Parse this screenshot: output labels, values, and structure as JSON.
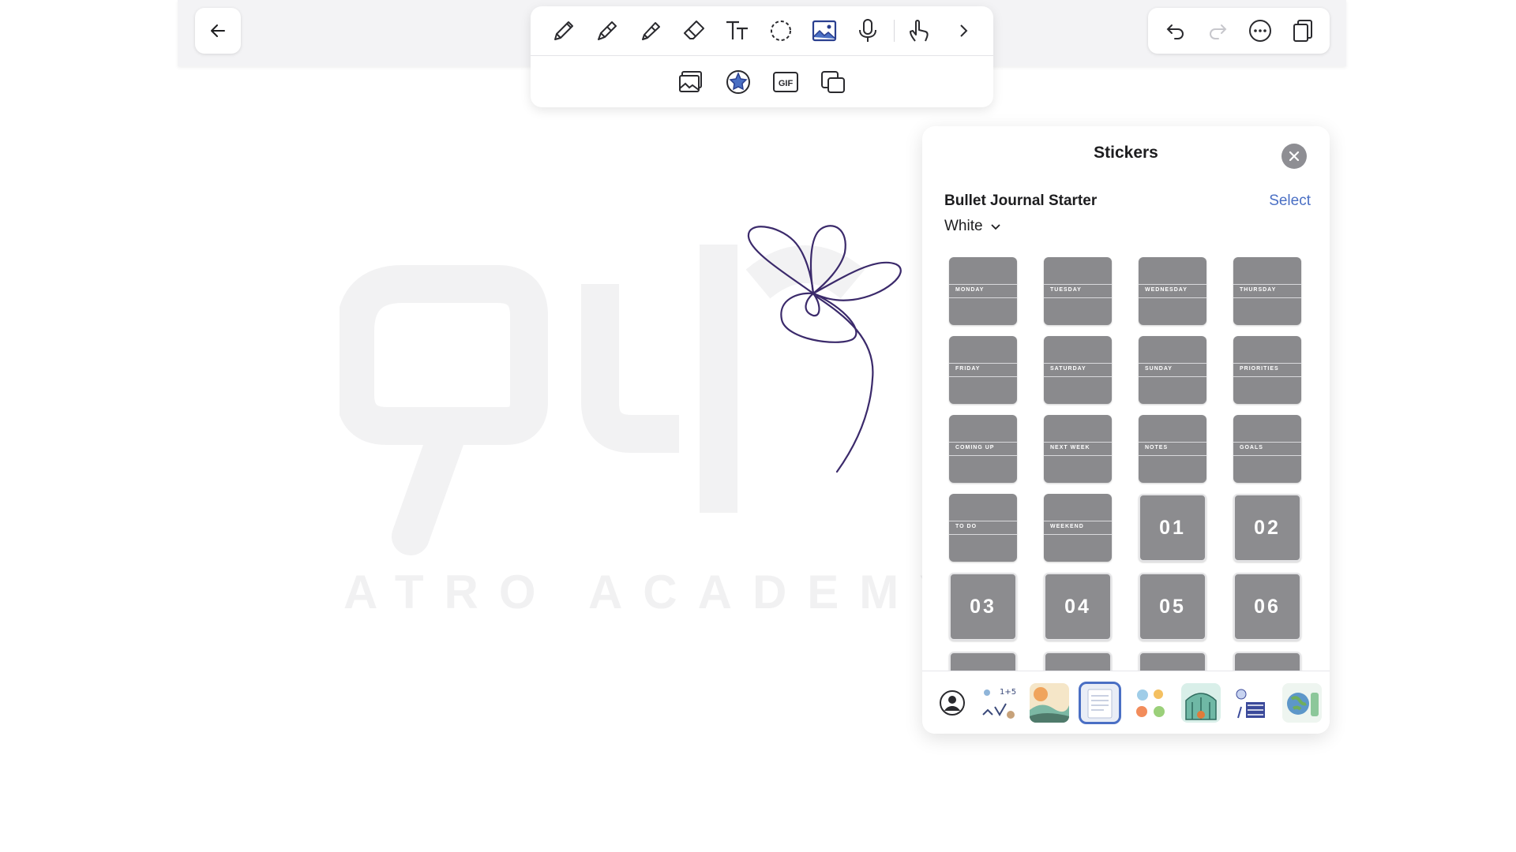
{
  "toolbar": {
    "tools": [
      "pencil-icon",
      "pen-icon",
      "highlighter-icon",
      "eraser-icon",
      "text-icon",
      "lasso-icon",
      "image-icon",
      "microphone-icon",
      "finger-touch-icon",
      "chevron-right-icon"
    ],
    "secondary": [
      "photo-library-icon",
      "sticker-icon",
      "gif-icon",
      "copy-sticker-icon"
    ],
    "active_tool": "image-icon",
    "active_secondary": "sticker-icon",
    "gif_label": "GIF"
  },
  "actions": [
    "undo-icon",
    "redo-icon",
    "more-icon",
    "pages-icon"
  ],
  "watermark": {
    "text": "ATRO ACADEMY"
  },
  "panel": {
    "title": "Stickers",
    "pack_name": "Bullet Journal Starter",
    "select_label": "Select",
    "variant": "White",
    "label_stickers": [
      "MONDAY",
      "TUESDAY",
      "WEDNESDAY",
      "THURSDAY",
      "FRIDAY",
      "SATURDAY",
      "SUNDAY",
      "PRIORITIES",
      "COMING UP",
      "NEXT WEEK",
      "NOTES",
      "GOALS",
      "TO DO",
      "WEEKEND"
    ],
    "number_stickers": [
      "01",
      "02",
      "03",
      "04",
      "05",
      "06"
    ],
    "footer_packs": [
      "my-stickers-icon",
      "doodle-pack",
      "landscape-pack",
      "bullet-journal-pack",
      "food-pack",
      "greenhouse-pack",
      "school-pack",
      "earth-pack"
    ],
    "active_pack": "bullet-journal-pack"
  },
  "colors": {
    "accent": "#4a6fc4",
    "ink": "#3b2a6b",
    "sticker_gray": "#8a8a8d"
  }
}
